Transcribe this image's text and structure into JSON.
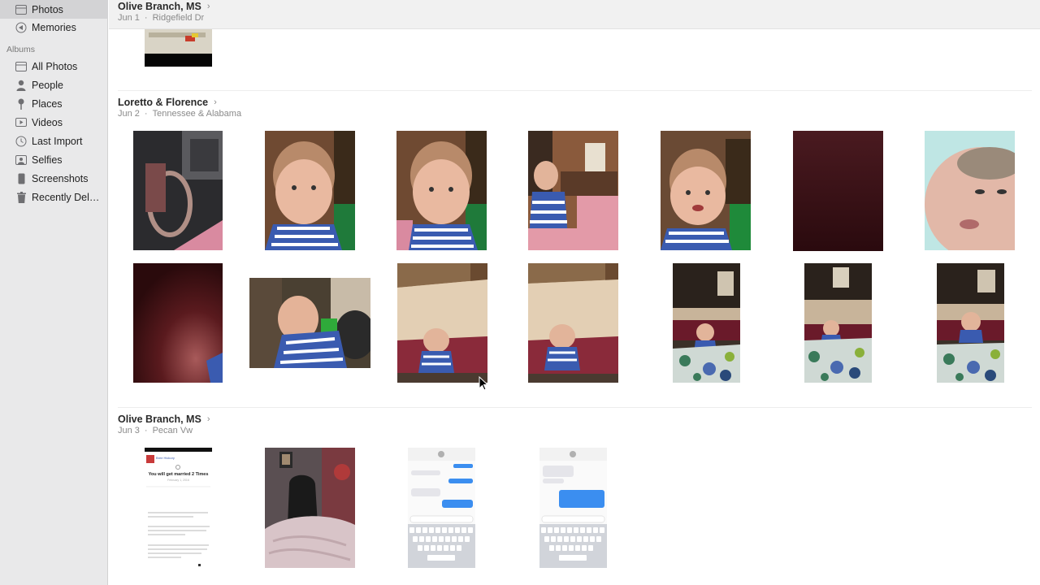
{
  "sidebar": {
    "section_albums": "Albums",
    "top_items": [
      {
        "label": "Photos",
        "icon": "photos-icon",
        "selected": true
      },
      {
        "label": "Memories",
        "icon": "memories-icon",
        "selected": false
      }
    ],
    "album_items": [
      {
        "label": "All Photos",
        "icon": "all-photos-icon"
      },
      {
        "label": "People",
        "icon": "person-icon"
      },
      {
        "label": "Places",
        "icon": "pin-icon"
      },
      {
        "label": "Videos",
        "icon": "video-icon"
      },
      {
        "label": "Last Import",
        "icon": "clock-icon"
      },
      {
        "label": "Selfies",
        "icon": "selfie-icon"
      },
      {
        "label": "Screenshots",
        "icon": "phone-icon"
      },
      {
        "label": "Recently Dele...",
        "icon": "trash-icon"
      }
    ]
  },
  "moments": [
    {
      "title": "Olive Branch, MS",
      "date": "Jun 1",
      "location": "Ridgefield Dr"
    },
    {
      "title": "Loretto & Florence",
      "date": "Jun 2",
      "location": "Tennessee & Alabama"
    },
    {
      "title": "Olive Branch, MS",
      "date": "Jun 3",
      "location": "Pecan Vw"
    }
  ],
  "chevron": "›",
  "separator": "·",
  "screenshot_texts": {
    "post_name": "Bree Hickory",
    "headline": "You will get married 2 Times",
    "date": "February 1, 2016"
  }
}
